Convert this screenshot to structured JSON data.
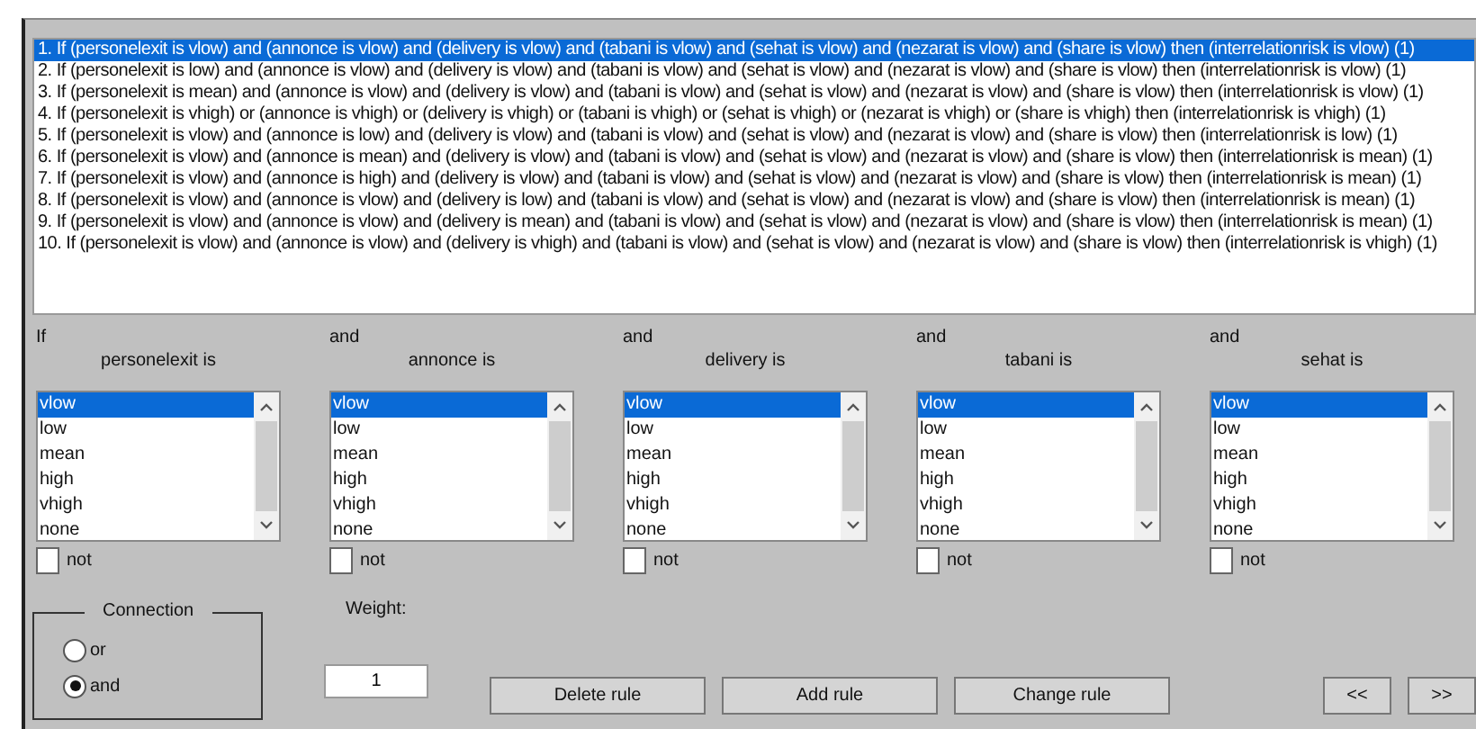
{
  "rules": [
    {
      "text": "1. If (personelexit is vlow) and (annonce is vlow) and (delivery is vlow) and (tabani is vlow) and (sehat is vlow) and (nezarat is vlow) and (share is vlow) then (interrelationrisk is vlow) (1)",
      "selected": true
    },
    {
      "text": "2. If (personelexit is low) and (annonce is vlow) and (delivery is vlow) and (tabani is vlow) and (sehat is vlow) and (nezarat is vlow) and (share is vlow) then (interrelationrisk is vlow) (1)",
      "selected": false
    },
    {
      "text": "3. If (personelexit is mean) and (annonce is vlow) and (delivery is vlow) and (tabani is vlow) and (sehat is vlow) and (nezarat is vlow) and (share is vlow) then (interrelationrisk is vlow) (1)",
      "selected": false
    },
    {
      "text": "4. If (personelexit is vhigh) or (annonce is vhigh) or (delivery is vhigh) or (tabani is vhigh) or (sehat is vhigh) or (nezarat is vhigh) or (share is vhigh) then (interrelationrisk is vhigh) (1)",
      "selected": false
    },
    {
      "text": "5. If (personelexit is vlow) and (annonce is low) and (delivery is vlow) and (tabani is vlow) and (sehat is vlow) and (nezarat is vlow) and (share is vlow) then (interrelationrisk is low) (1)",
      "selected": false
    },
    {
      "text": "6. If (personelexit is vlow) and (annonce is mean) and (delivery is vlow) and (tabani is vlow) and (sehat is vlow) and (nezarat is vlow) and (share is vlow) then (interrelationrisk is mean) (1)",
      "selected": false
    },
    {
      "text": "7. If (personelexit is vlow) and (annonce is high) and (delivery is vlow) and (tabani is vlow) and (sehat is vlow) and (nezarat is vlow) and (share is vlow) then (interrelationrisk is mean) (1)",
      "selected": false
    },
    {
      "text": "8. If (personelexit is vlow) and (annonce is vlow) and (delivery is low) and (tabani is vlow) and (sehat is vlow) and (nezarat is vlow) and (share is vlow) then (interrelationrisk is mean) (1)",
      "selected": false
    },
    {
      "text": "9. If (personelexit is vlow) and (annonce is vlow) and (delivery is mean) and (tabani is vlow) and (sehat is vlow) and (nezarat is vlow) and (share is vlow) then (interrelationrisk is mean) (1)",
      "selected": false
    },
    {
      "text": "10. If (personelexit is vlow) and (annonce is vlow) and (delivery is vhigh) and (tabani is vlow) and (sehat is vlow) and (nezarat is vlow) and (share is vlow) then (interrelationrisk is vhigh) (1)",
      "selected": false
    }
  ],
  "inputs": [
    {
      "connective": "If",
      "label": "personelexit is",
      "not": false,
      "options": [
        {
          "label": "vlow",
          "selected": true
        },
        {
          "label": "low",
          "selected": false
        },
        {
          "label": "mean",
          "selected": false
        },
        {
          "label": "high",
          "selected": false
        },
        {
          "label": "vhigh",
          "selected": false
        },
        {
          "label": "none",
          "selected": false
        }
      ],
      "not_label": "not"
    },
    {
      "connective": "and",
      "label": "annonce is",
      "not": false,
      "options": [
        {
          "label": "vlow",
          "selected": true
        },
        {
          "label": "low",
          "selected": false
        },
        {
          "label": "mean",
          "selected": false
        },
        {
          "label": "high",
          "selected": false
        },
        {
          "label": "vhigh",
          "selected": false
        },
        {
          "label": "none",
          "selected": false
        }
      ],
      "not_label": "not"
    },
    {
      "connective": "and",
      "label": "delivery is",
      "not": false,
      "options": [
        {
          "label": "vlow",
          "selected": true
        },
        {
          "label": "low",
          "selected": false
        },
        {
          "label": "mean",
          "selected": false
        },
        {
          "label": "high",
          "selected": false
        },
        {
          "label": "vhigh",
          "selected": false
        },
        {
          "label": "none",
          "selected": false
        }
      ],
      "not_label": "not"
    },
    {
      "connective": "and",
      "label": "tabani is",
      "not": false,
      "options": [
        {
          "label": "vlow",
          "selected": true
        },
        {
          "label": "low",
          "selected": false
        },
        {
          "label": "mean",
          "selected": false
        },
        {
          "label": "high",
          "selected": false
        },
        {
          "label": "vhigh",
          "selected": false
        },
        {
          "label": "none",
          "selected": false
        }
      ],
      "not_label": "not"
    },
    {
      "connective": "and",
      "label": "sehat is",
      "not": false,
      "options": [
        {
          "label": "vlow",
          "selected": true
        },
        {
          "label": "low",
          "selected": false
        },
        {
          "label": "mean",
          "selected": false
        },
        {
          "label": "high",
          "selected": false
        },
        {
          "label": "vhigh",
          "selected": false
        },
        {
          "label": "none",
          "selected": false
        }
      ],
      "not_label": "not"
    }
  ],
  "connection": {
    "title": "Connection",
    "options": [
      {
        "label": "or",
        "selected": false
      },
      {
        "label": "and",
        "selected": true
      }
    ]
  },
  "weight": {
    "label": "Weight:",
    "value": "1"
  },
  "buttons": [
    "Delete rule",
    "Add rule",
    "Change rule"
  ],
  "nav_buttons": [
    "<<",
    ">>"
  ]
}
